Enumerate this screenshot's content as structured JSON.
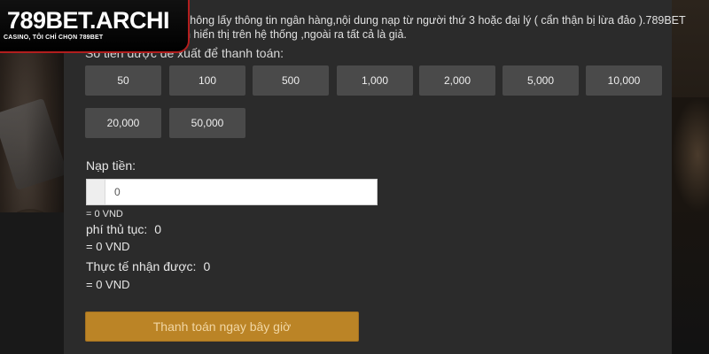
{
  "logo": {
    "text": "789BET.ARCHI",
    "tagline": "CASINO, TÔI CHỈ CHỌN 789BET"
  },
  "notice": {
    "line1": "không lấy thông tin ngân hàng,nội dung nạp từ người thứ 3 hoặc đại lý ( cẩn thận bị lừa đảo ).789BET",
    "line2": "n hiển thị trên hệ thống ,ngoài ra tất cả là giả."
  },
  "amounts": {
    "title": "Số tiền được đề xuất để thanh toán:",
    "options": [
      "50",
      "100",
      "500",
      "1,000",
      "2,000",
      "5,000",
      "10,000",
      "20,000",
      "50,000"
    ]
  },
  "deposit": {
    "label": "Nạp tiền:",
    "input_value": "",
    "placeholder": "0",
    "equivalent": "= 0 VND"
  },
  "fee": {
    "label": "phí thủ tục:",
    "value": "0",
    "equivalent": "= 0 VND"
  },
  "received": {
    "label": "Thực tế nhận được:",
    "value": "0",
    "equivalent": "= 0 VND"
  },
  "pay_button": "Thanh toán ngay bây giờ",
  "colors": {
    "panel": "#2b2b2b",
    "amount_button": "#4a4a4a",
    "pay_button": "#bb8426",
    "logo_border": "#b21e1e"
  }
}
